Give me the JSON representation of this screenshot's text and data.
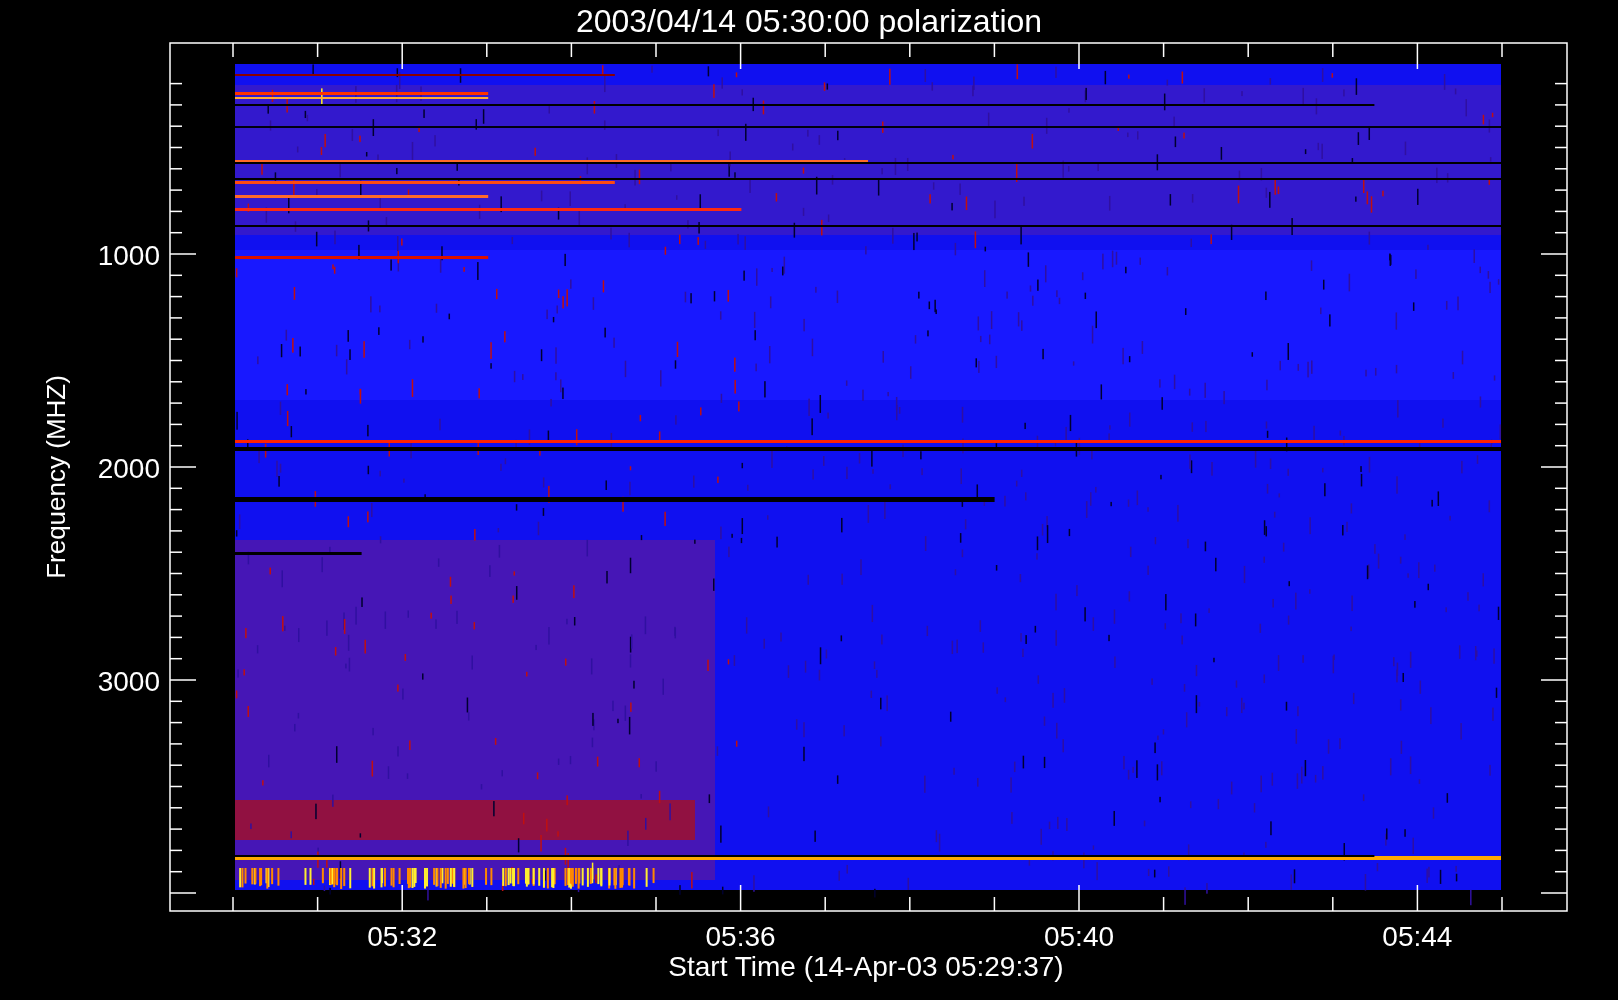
{
  "title": "2003/04/14 05:30:00 polarization",
  "y_axis": {
    "label": "Frequency (MHZ)",
    "ticks": [
      "1000",
      "2000",
      "3000"
    ]
  },
  "x_axis": {
    "label": "Start Time (14-Apr-03 05:29:37)",
    "ticks": [
      "05:32",
      "05:36",
      "05:40",
      "05:44"
    ]
  }
}
